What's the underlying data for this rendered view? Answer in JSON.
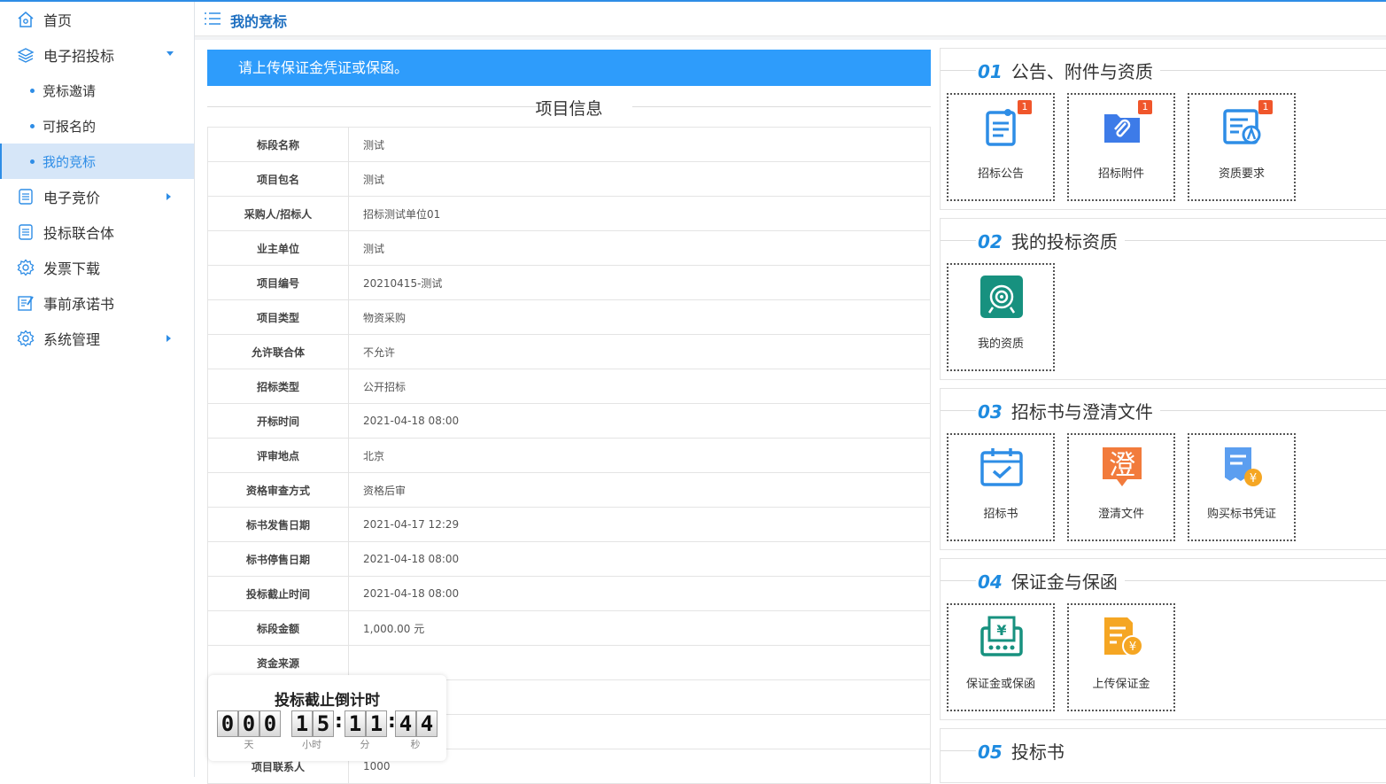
{
  "sidebar": {
    "items": [
      {
        "label": "首页",
        "icon": "home-icon"
      },
      {
        "label": "电子招投标",
        "icon": "layers-icon"
      },
      {
        "label": "竞标邀请"
      },
      {
        "label": "可报名的"
      },
      {
        "label": "我的竞标"
      },
      {
        "label": "电子竞价",
        "icon": "list-icon"
      },
      {
        "label": "投标联合体",
        "icon": "list-icon"
      },
      {
        "label": "发票下载",
        "icon": "gear-icon"
      },
      {
        "label": "事前承诺书",
        "icon": "edit-icon"
      },
      {
        "label": "系统管理",
        "icon": "gear-icon"
      }
    ]
  },
  "header": {
    "title": "我的竞标"
  },
  "notice": "请上传保证金凭证或保函。",
  "section_title": "项目信息",
  "info": [
    {
      "key": "标段名称",
      "value": "测试"
    },
    {
      "key": "项目包名",
      "value": "测试"
    },
    {
      "key": "采购人/招标人",
      "value": "招标测试单位01"
    },
    {
      "key": "业主单位",
      "value": "测试"
    },
    {
      "key": "项目编号",
      "value": "20210415-测试"
    },
    {
      "key": "项目类型",
      "value": "物资采购"
    },
    {
      "key": "允许联合体",
      "value": "不允许"
    },
    {
      "key": "招标类型",
      "value": "公开招标"
    },
    {
      "key": "开标时间",
      "value": "2021-04-18 08:00"
    },
    {
      "key": "评审地点",
      "value": "北京"
    },
    {
      "key": "资格审查方式",
      "value": "资格后审"
    },
    {
      "key": "标书发售日期",
      "value": "2021-04-17 12:29"
    },
    {
      "key": "标书停售日期",
      "value": "2021-04-18 08:00"
    },
    {
      "key": "投标截止时间",
      "value": "2021-04-18 08:00"
    },
    {
      "key": "标段金额",
      "value": "1,000.00 元"
    },
    {
      "key": "资金来源",
      "value": ""
    },
    {
      "key": "",
      "value": ""
    },
    {
      "key": "",
      "value": ""
    },
    {
      "key": "项目联系人",
      "value": "1000"
    }
  ],
  "countdown": {
    "title": "投标截止倒计时",
    "days": [
      "0",
      "0",
      "0"
    ],
    "hours": [
      "1",
      "5"
    ],
    "minutes": [
      "1",
      "1"
    ],
    "seconds": [
      "4",
      "4"
    ],
    "units": {
      "day": "天",
      "hour": "小时",
      "minute": "分",
      "second": "秒"
    }
  },
  "panels": [
    {
      "num": "01",
      "title": "公告、附件与资质",
      "tiles": [
        {
          "label": "招标公告",
          "badge": "1",
          "icon": "announcement-icon",
          "color": "#2e8de6"
        },
        {
          "label": "招标附件",
          "badge": "1",
          "icon": "attachment-folder-icon",
          "color": "#3d7be8"
        },
        {
          "label": "资质要求",
          "badge": "1",
          "icon": "qualification-doc-icon",
          "color": "#2e8de6"
        }
      ]
    },
    {
      "num": "02",
      "title": "我的投标资质",
      "tiles": [
        {
          "label": "我的资质",
          "icon": "target-icon",
          "color": "#17917f"
        }
      ]
    },
    {
      "num": "03",
      "title": "招标书与澄清文件",
      "tiles": [
        {
          "label": "招标书",
          "icon": "calendar-check-icon",
          "color": "#2e8de6"
        },
        {
          "label": "澄清文件",
          "icon": "clarify-icon",
          "glyph": "澄",
          "color": "#f27b3c"
        },
        {
          "label": "购买标书凭证",
          "icon": "receipt-yuan-icon",
          "color": "#3d8ae8"
        }
      ]
    },
    {
      "num": "04",
      "title": "保证金与保函",
      "tiles": [
        {
          "label": "保证金或保函",
          "icon": "deposit-icon",
          "color": "#17917f"
        },
        {
          "label": "上传保证金",
          "icon": "upload-deposit-icon",
          "color": "#f5a623"
        }
      ]
    },
    {
      "num": "05",
      "title": "投标书",
      "tiles": []
    }
  ]
}
